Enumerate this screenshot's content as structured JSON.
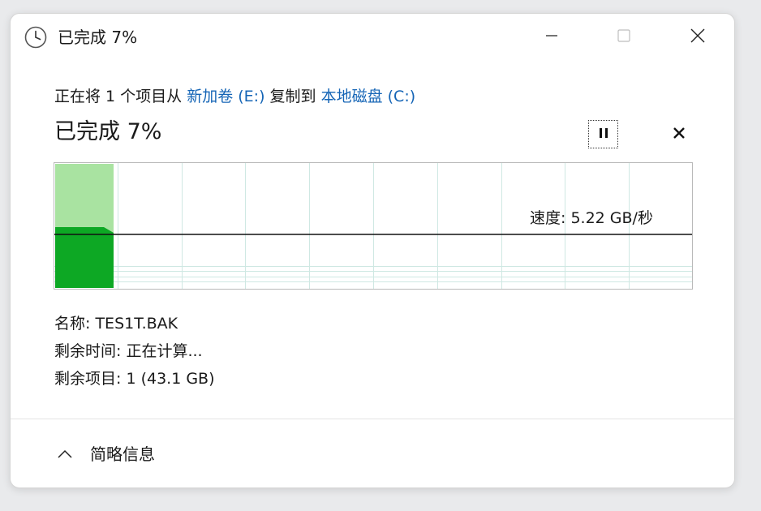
{
  "window": {
    "title": "已完成 7%",
    "icon": "clock-icon",
    "controls": {
      "minimize": "minimize-icon",
      "maximize": "maximize-icon",
      "close": "close-icon"
    }
  },
  "copy": {
    "prefix": "正在将 1 个项目从 ",
    "source": "新加卷 (E:)",
    "middle": " 复制到 ",
    "destination": "本地磁盘 (C:)",
    "link_color": "#1565b6"
  },
  "progress": {
    "title": "已完成 7%",
    "fraction": 0.07,
    "pause_icon": "pause-icon",
    "cancel_icon": "close-icon"
  },
  "graph": {
    "speed_label": "速度: 5.22 GB/秒",
    "fill_light": "#a9e3a1",
    "fill_dark": "#0da824",
    "grid_color": "#cfe8e3"
  },
  "details": {
    "name_label": "名称: ",
    "name_value": "TES1T.BAK",
    "time_label": "剩余时间: ",
    "time_value": "正在计算...",
    "items_label": "剩余项目: ",
    "items_value": "1 (43.1 GB)"
  },
  "footer": {
    "toggle_icon": "chevron-up-icon",
    "label": "简略信息"
  }
}
